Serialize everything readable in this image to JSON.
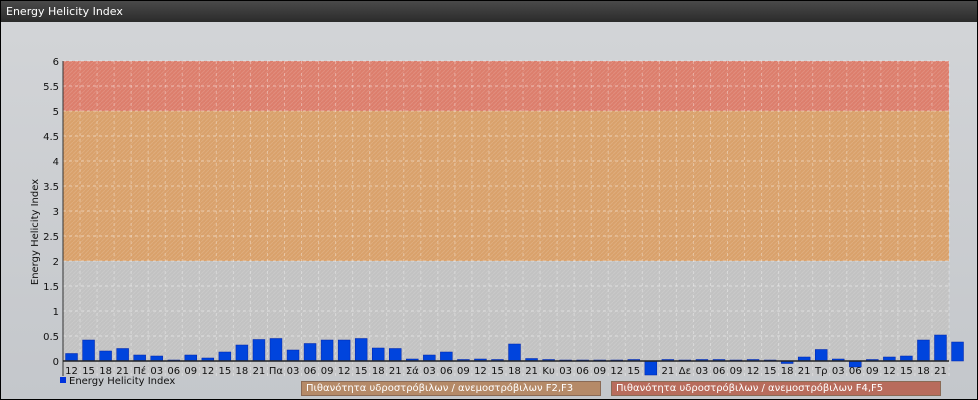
{
  "window": {
    "title": "Energy Helicity Index"
  },
  "chart_data": {
    "type": "bar",
    "title": "",
    "ylabel": "Energy Helicity Index",
    "xlabel": "",
    "ylim": [
      -0.3,
      6
    ],
    "yticks": [
      "0",
      "0.5",
      "1",
      "1.5",
      "2",
      "2.5",
      "3",
      "3.5",
      "4",
      "4.5",
      "5",
      "5.5",
      "6"
    ],
    "grid": true,
    "legend_position": "bottom-left",
    "categories": [
      "12",
      "15",
      "18",
      "21",
      "Πέ",
      "03",
      "06",
      "09",
      "12",
      "15",
      "18",
      "21",
      "Πα",
      "03",
      "06",
      "09",
      "12",
      "15",
      "18",
      "21",
      "Σά",
      "03",
      "06",
      "09",
      "12",
      "15",
      "18",
      "21",
      "Κυ",
      "03",
      "06",
      "09",
      "12",
      "15",
      "",
      "21",
      "Δε",
      "03",
      "06",
      "09",
      "12",
      "15",
      "18",
      "21",
      "Τρ",
      "03",
      "06",
      "09",
      "12",
      "15",
      "18",
      "21"
    ],
    "series": [
      {
        "name": "Energy Helicity Index",
        "color": "#0044dd",
        "values": [
          0.15,
          0.42,
          0.2,
          0.25,
          0.12,
          0.1,
          0.02,
          0.12,
          0.06,
          0.18,
          0.32,
          0.43,
          0.45,
          0.22,
          0.35,
          0.42,
          0.42,
          0.45,
          0.26,
          0.25,
          0.04,
          0.12,
          0.18,
          0.03,
          0.04,
          0.03,
          0.34,
          0.05,
          0.03,
          0.02,
          0.02,
          0.02,
          0.02,
          0.03,
          -0.28,
          0.03,
          0.02,
          0.03,
          0.03,
          0.02,
          0.03,
          0.02,
          -0.05,
          0.08,
          0.23,
          0.04,
          -0.12,
          0.03,
          0.08,
          0.1,
          0.42,
          0.52,
          0.38
        ]
      }
    ],
    "bands": [
      {
        "from": 0,
        "to": 2,
        "color": "#c2c2c2"
      },
      {
        "from": 2,
        "to": 5,
        "color": "#d9a16b",
        "label": "Πιθανότητα υδροστρόβιλων / ανεμοστρόβιλων F2,F3"
      },
      {
        "from": 5,
        "to": 6,
        "color": "#dc7e6c",
        "label": "Πιθανότητα υδροστρόβιλων / ανεμοστρόβιλων F4,F5"
      }
    ]
  }
}
